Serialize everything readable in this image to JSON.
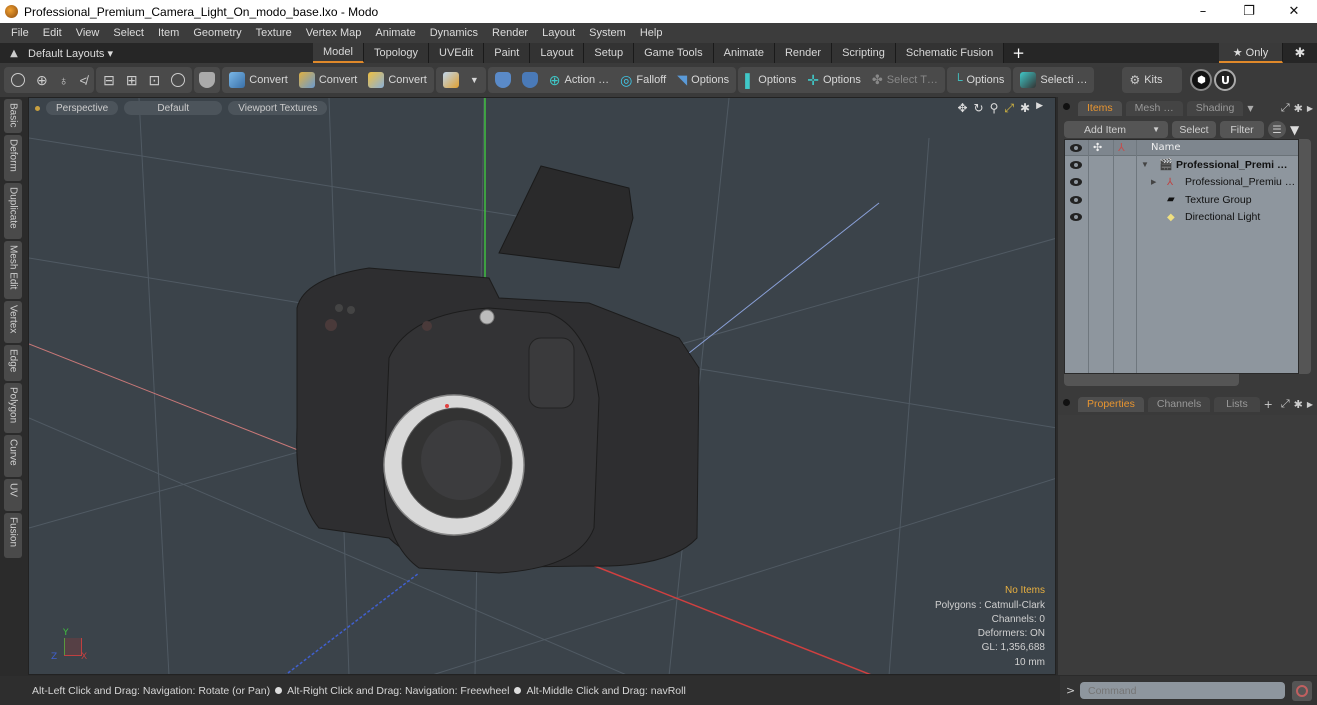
{
  "window": {
    "title": "Professional_Premium_Camera_Light_On_modo_base.lxo - Modo",
    "minimize": "–",
    "restore": "❐",
    "close": "✕"
  },
  "menubar": [
    "File",
    "Edit",
    "View",
    "Select",
    "Item",
    "Geometry",
    "Texture",
    "Vertex Map",
    "Animate",
    "Dynamics",
    "Render",
    "Layout",
    "System",
    "Help"
  ],
  "layoutbar": {
    "preset_label": "Default Layouts ▾",
    "tabs": [
      "Model",
      "Topology",
      "UVEdit",
      "Paint",
      "Layout",
      "Setup",
      "Game Tools",
      "Animate",
      "Render",
      "Scripting",
      "Schematic Fusion"
    ],
    "active_tab": "Model",
    "add_tab": "+",
    "only_label": "★ Only"
  },
  "toolbar": {
    "convert1": "Convert",
    "convert2": "Convert",
    "convert3": "Convert",
    "action": "Action …",
    "falloff": "Falloff",
    "options1": "Options",
    "options2": "Options",
    "options3": "Options",
    "select_t": "Select T…",
    "options4": "Options",
    "selecti": "Selecti …",
    "kits": "Kits"
  },
  "left_tabs": [
    "Basic",
    "Deform",
    "Duplicate",
    "Mesh Edit",
    "Vertex",
    "Edge",
    "Polygon",
    "Curve",
    "UV",
    "Fusion"
  ],
  "viewport": {
    "view_mode": "Perspective",
    "shading": "Default",
    "textures": "Viewport Textures",
    "info": {
      "items": "No Items",
      "polygons": "Polygons : Catmull-Clark",
      "channels": "Channels: 0",
      "deformers": "Deformers: ON",
      "gl": "GL: 1,356,688",
      "scale": "10 mm"
    },
    "axis": {
      "y": "Y",
      "z": "Z",
      "x": "X"
    },
    "colors": {
      "x_axis": "#c84040",
      "y_axis": "#40c040",
      "z_axis": "#4060d0",
      "bg": "#3b434a"
    }
  },
  "status": {
    "hint1": "Alt-Left Click and Drag: Navigation: Rotate (or Pan)",
    "hint2": "Alt-Right Click and Drag: Navigation: Freewheel",
    "hint3": "Alt-Middle Click and Drag: navRoll"
  },
  "items_panel": {
    "tabs": [
      "Items",
      "Mesh …",
      "Shading"
    ],
    "active_tab": "Items",
    "add_item": "Add Item",
    "select": "Select",
    "filter": "Filter",
    "column_name": "Name",
    "rows": [
      {
        "label": "Professional_Premi …",
        "bold": true,
        "indent": 0
      },
      {
        "label": "Professional_Premiu …",
        "bold": false,
        "indent": 1
      },
      {
        "label": "Texture Group",
        "bold": false,
        "indent": 1
      },
      {
        "label": "Directional Light",
        "bold": false,
        "indent": 1
      }
    ]
  },
  "properties_panel": {
    "tabs": [
      "Properties",
      "Channels",
      "Lists"
    ],
    "active_tab": "Properties",
    "add": "+"
  },
  "command": {
    "prompt": ">",
    "placeholder": "Command"
  },
  "accent_color": "#e0892a"
}
